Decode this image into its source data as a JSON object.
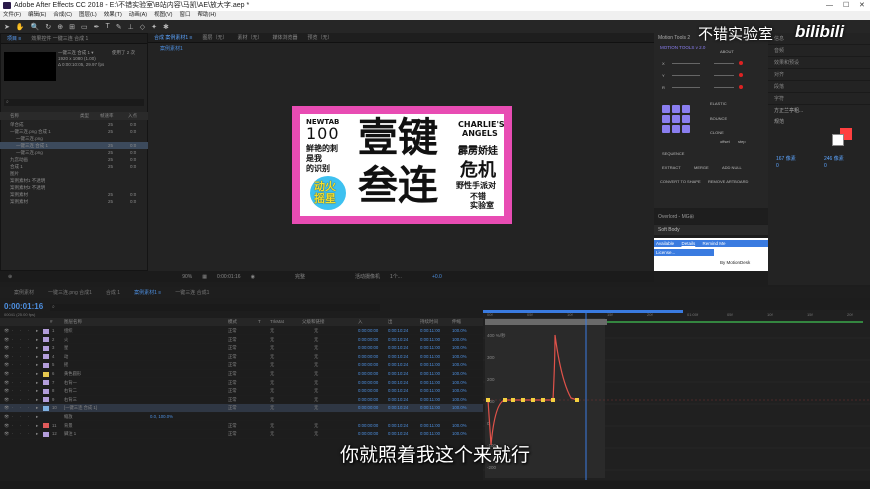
{
  "window": {
    "title": "Adobe After Effects CC 2018 - E:\\不错实验室\\B站内容\\马凯\\AE\\放大字.aep *",
    "controls": [
      "—",
      "☐",
      "✕"
    ]
  },
  "menu": [
    "文件(F)",
    "编辑(E)",
    "合成(C)",
    "图层(L)",
    "效果(T)",
    "动画(A)",
    "视图(V)",
    "窗口",
    "帮助(H)"
  ],
  "project": {
    "tabs": [
      "项目 ≡",
      "效果控件 一键三连 合成 1",
      "一键三连 合成 1 ▾",
      "使用了 2 次"
    ],
    "info": [
      "1920 x 1080 (1.00)",
      "Δ 0:00:10:05, 29.97 fps"
    ],
    "columns": [
      "名称",
      "类型",
      "帧速率",
      "入点"
    ],
    "rows": [
      {
        "name": "单合成",
        "rate": "25",
        "in": "0:0"
      },
      {
        "name": "一键三连.png 合成 1",
        "rate": "25",
        "in": "0:0"
      },
      {
        "name": "一键三连.png",
        "rate": "",
        "in": ""
      },
      {
        "name": "一键三连 合成 1",
        "rate": "25",
        "in": "0:0"
      },
      {
        "name": "一键三连.png",
        "rate": "25",
        "in": "0:0"
      },
      {
        "name": "九宫动画",
        "rate": "25",
        "in": "0:0"
      },
      {
        "name": "合成 1",
        "rate": "25",
        "in": "0:0"
      },
      {
        "name": "图片",
        "rate": "",
        "in": ""
      },
      {
        "name": "案例素材1 不透明",
        "rate": "",
        "in": ""
      },
      {
        "name": "案例素材2 不透明",
        "rate": "",
        "in": ""
      },
      {
        "name": "案例素材",
        "rate": "25",
        "in": "0:0"
      },
      {
        "name": "案例素材",
        "rate": "25",
        "in": "0:0"
      }
    ],
    "bpc": "8 bpc"
  },
  "viewer": {
    "tabs": [
      "合成 案例素材1 ≡",
      "图层（无）",
      "素材（无）",
      "媒体浏览器",
      "预览（无）"
    ],
    "subtab": "案例素材1",
    "bar": {
      "zoom": "90%",
      "time": "0:00:01:16",
      "quality": "完整",
      "camera": "活动摄像机",
      "views": "1个...",
      "offset": "+0.0"
    },
    "poster": {
      "newtab": "NEWTAB",
      "hundred": "100",
      "line1": "鲜艳的刺",
      "line2": "是我",
      "line3": "的识别",
      "stamp": "动火\n摇星",
      "big1": "壹键",
      "big2": "叁连",
      "charlie1": "CHARLIE'S",
      "charlie2": "ANGELS",
      "r1": "霹雳娇娃",
      "r2": "危机",
      "r3": "野性手派对",
      "r4": "不错\n实验室"
    }
  },
  "motion_tools": {
    "title": "Motion Tools 2",
    "brand": "MOTION TOOLS v 2.0",
    "about": "ABOUT",
    "sliders": [
      "X",
      "Y",
      "R"
    ],
    "rows": [
      [
        "ELASTIC",
        "BOUNCE",
        "CLONE"
      ],
      [
        "SEQUENCE",
        "EXTRACT",
        "MERGE",
        "ADD NULL"
      ],
      [
        "CONVERT TO SHAPE",
        "REMOVE ARTBOARD"
      ]
    ],
    "offset": "offset",
    "step": "step"
  },
  "overflow": "Overlord - MG⊞",
  "softbody": "Soft Body",
  "license": {
    "available": "Available",
    "details": "Details",
    "remind": "Remind Me",
    "license_link": "License...",
    "by": "By MotionDesk"
  },
  "right_panels": [
    "信息",
    "音频",
    "效果和预设",
    "对齐",
    "段落",
    "字符",
    "方正兰亭粗...",
    "规范",
    "px",
    "px"
  ],
  "right_values": {
    "size": "167 像素",
    "leading": "246 像素",
    "tracking": "0",
    "kerning": "0"
  },
  "timeline": {
    "tabs": [
      "案例素材",
      "一键三连.png 合成1",
      "合成 1",
      "案例素材1 ≡",
      "一键三连 合成1"
    ],
    "time": "0:00:01:16",
    "fps": "00041 (25.00 fps)",
    "columns": [
      "#",
      "图层名称",
      "模式",
      "T",
      "TrkMat",
      "父级和链接",
      "入",
      "出",
      "持续时间",
      "伸缩"
    ],
    "layers": [
      {
        "num": "1",
        "name": "组织",
        "mode": "正常",
        "trk": "无",
        "parent": "无",
        "in": "0:00:00:00",
        "out": "0:00:10:24",
        "dur": "0:00:11:00",
        "str": "100.0%",
        "color": "#b39ddb"
      },
      {
        "num": "2",
        "name": "火",
        "mode": "正常",
        "trk": "无",
        "parent": "无",
        "in": "0:00:00:00",
        "out": "0:00:10:24",
        "dur": "0:00:11:00",
        "str": "100.0%",
        "color": "#b39ddb"
      },
      {
        "num": "3",
        "name": "星",
        "mode": "正常",
        "trk": "无",
        "parent": "无",
        "in": "0:00:00:00",
        "out": "0:00:10:24",
        "dur": "0:00:11:00",
        "str": "100.0%",
        "color": "#b39ddb"
      },
      {
        "num": "4",
        "name": "动",
        "mode": "正常",
        "trk": "无",
        "parent": "无",
        "in": "0:00:00:00",
        "out": "0:00:10:24",
        "dur": "0:00:11:00",
        "str": "100.0%",
        "color": "#b39ddb"
      },
      {
        "num": "5",
        "name": "摇",
        "mode": "正常",
        "trk": "无",
        "parent": "无",
        "in": "0:00:00:00",
        "out": "0:00:10:24",
        "dur": "0:00:11:00",
        "str": "100.0%",
        "color": "#b39ddb"
      },
      {
        "num": "6",
        "name": "黄色圆形",
        "mode": "正常",
        "trk": "无",
        "parent": "无",
        "in": "0:00:00:00",
        "out": "0:00:10:24",
        "dur": "0:00:11:00",
        "str": "100.0%",
        "color": "#e6c84f"
      },
      {
        "num": "7",
        "name": "右背一",
        "mode": "正常",
        "trk": "无",
        "parent": "无",
        "in": "0:00:00:00",
        "out": "0:00:10:24",
        "dur": "0:00:11:00",
        "str": "100.0%",
        "color": "#b39ddb"
      },
      {
        "num": "8",
        "name": "右背二",
        "mode": "正常",
        "trk": "无",
        "parent": "无",
        "in": "0:00:00:00",
        "out": "0:00:10:24",
        "dur": "0:00:11:00",
        "str": "100.0%",
        "color": "#b39ddb"
      },
      {
        "num": "9",
        "name": "右背三",
        "mode": "正常",
        "trk": "无",
        "parent": "无",
        "in": "0:00:00:00",
        "out": "0:00:10:24",
        "dur": "0:00:11:00",
        "str": "100.0%",
        "color": "#b39ddb"
      },
      {
        "num": "10",
        "name": "[一键三连 合成 1]",
        "mode": "正常",
        "trk": "无",
        "parent": "无",
        "in": "0:00:00:00",
        "out": "0:00:10:24",
        "dur": "0:00:11:00",
        "str": "100.0%",
        "color": "#7fb0e0"
      },
      {
        "num": "",
        "name": "缩放",
        "mode": "",
        "trk": "",
        "parent": "",
        "in": "",
        "out": "",
        "dur": "",
        "str": "",
        "color": ""
      },
      {
        "num": "11",
        "name": "背景",
        "mode": "正常",
        "trk": "无",
        "parent": "无",
        "in": "0:00:00:00",
        "out": "0:00:10:24",
        "dur": "0:00:11:00",
        "str": "100.0%",
        "color": "#e05a5a"
      },
      {
        "num": "12",
        "name": "脚注 1",
        "mode": "正常",
        "trk": "无",
        "parent": "无",
        "in": "0:00:00:00",
        "out": "0:00:10:24",
        "dur": "0:00:11:00",
        "str": "100.0%",
        "color": "#b39ddb"
      }
    ],
    "scale_value": "0.0, 100.0%"
  },
  "graph": {
    "labels": [
      "400 %/秒",
      "300",
      "200",
      "100",
      "0",
      "-100",
      "-200"
    ],
    "ruler": [
      "00f",
      "05f",
      "10f",
      "15f",
      "20f",
      "01:00f",
      "05f",
      "10f",
      "15f",
      "20f"
    ]
  },
  "overlay": {
    "watermark": "不错实验室",
    "bili": "bilibili",
    "subtitle": "你就照着我这个来就行"
  }
}
